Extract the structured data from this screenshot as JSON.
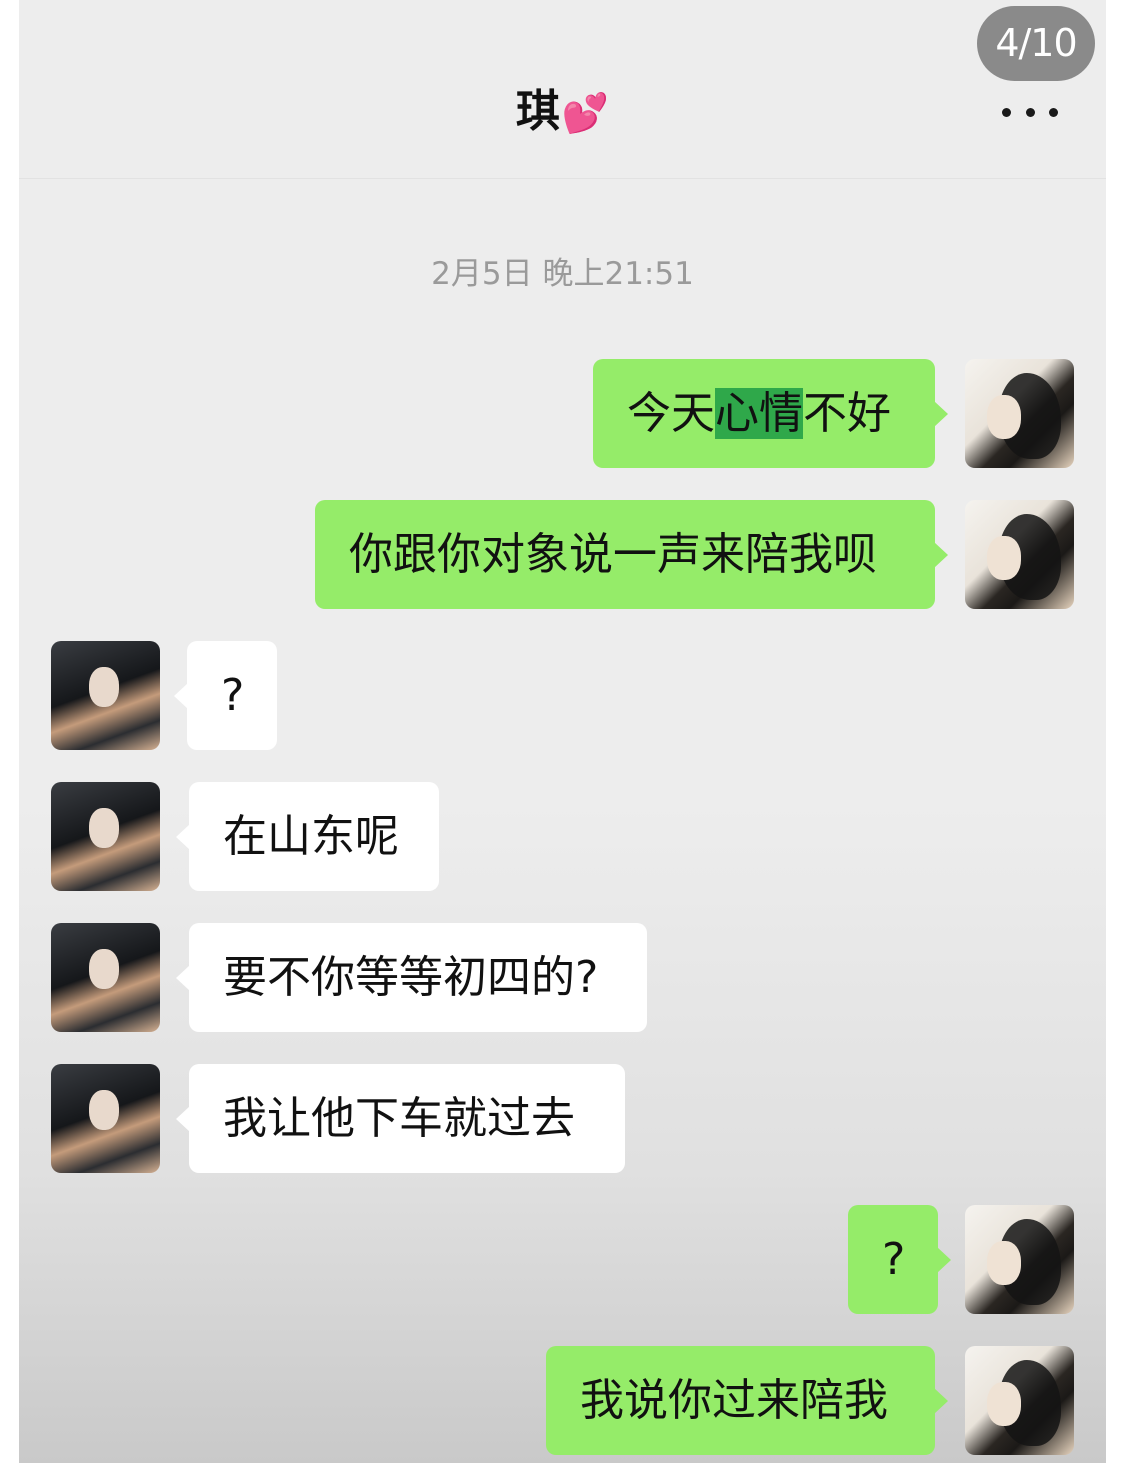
{
  "pager": "4/10",
  "header": {
    "title": "琪",
    "emoji": "💕",
    "more_icon": "more-dots-icon"
  },
  "timestamp": "2月5日 晚上21:51",
  "messages": [
    {
      "side": "self",
      "text_before": "今天",
      "text_highlight": "心情",
      "text_after": "不好"
    },
    {
      "side": "self",
      "text": "你跟你对象说一声来陪我呗"
    },
    {
      "side": "friend",
      "text": "?"
    },
    {
      "side": "friend",
      "text": "在山东呢"
    },
    {
      "side": "friend",
      "text": "要不你等等初四的?"
    },
    {
      "side": "friend",
      "text": "我让他下车就过去"
    },
    {
      "side": "self",
      "text": "?"
    },
    {
      "side": "self",
      "text": "我说你过来陪我"
    }
  ],
  "colors": {
    "self_bubble": "#95ec69",
    "friend_bubble": "#ffffff",
    "background": "#ededed",
    "highlight": "#2fa84a"
  }
}
